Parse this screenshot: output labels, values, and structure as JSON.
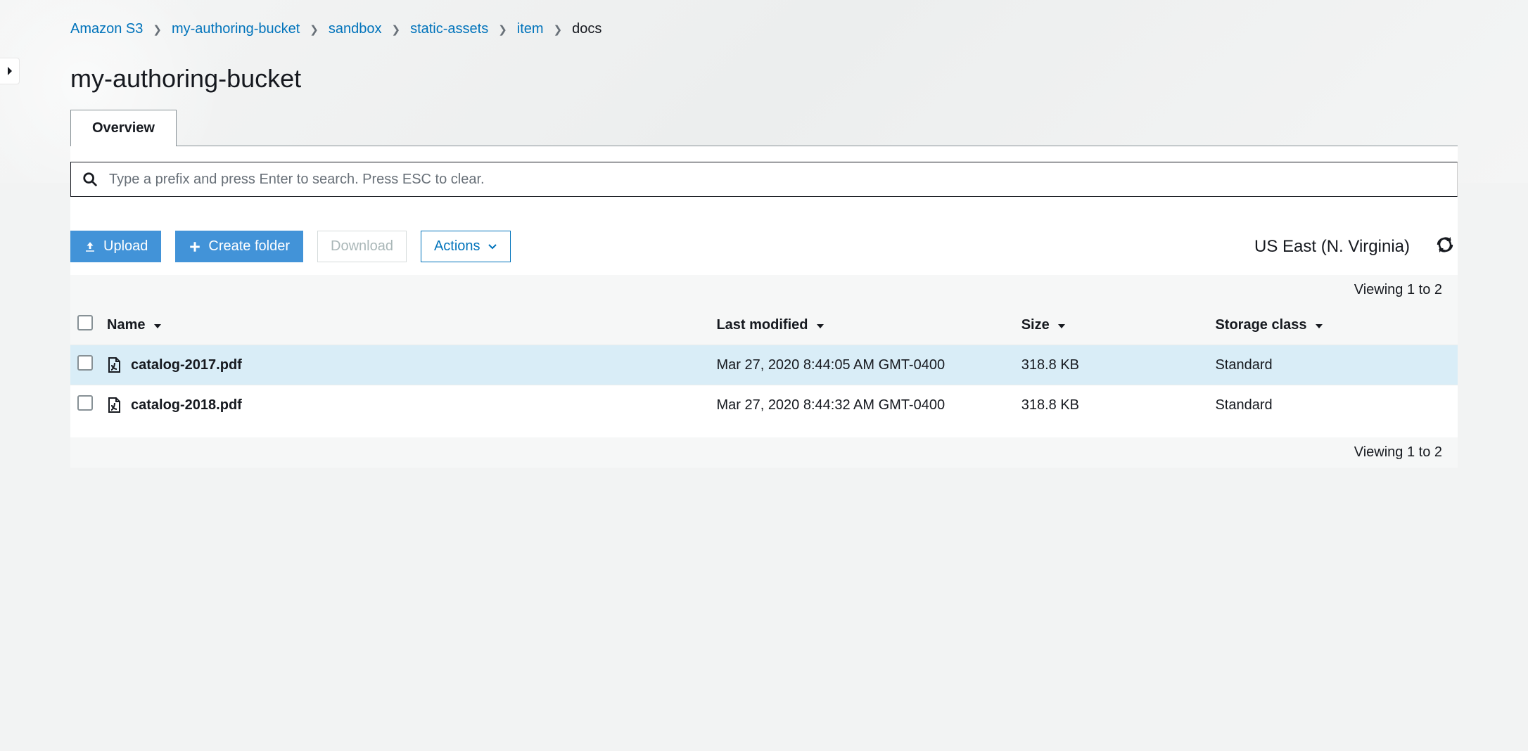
{
  "breadcrumb": {
    "items": [
      {
        "label": "Amazon S3",
        "link": true
      },
      {
        "label": "my-authoring-bucket",
        "link": true
      },
      {
        "label": "sandbox",
        "link": true
      },
      {
        "label": "static-assets",
        "link": true
      },
      {
        "label": "item",
        "link": true
      },
      {
        "label": "docs",
        "link": false
      }
    ]
  },
  "page_title": "my-authoring-bucket",
  "tabs": {
    "overview": "Overview"
  },
  "search": {
    "placeholder": "Type a prefix and press Enter to search. Press ESC to clear."
  },
  "toolbar": {
    "upload": "Upload",
    "create_folder": "Create folder",
    "download": "Download",
    "actions": "Actions",
    "region": "US East (N. Virginia)"
  },
  "viewing_top": "Viewing 1 to 2",
  "viewing_bottom": "Viewing 1 to 2",
  "columns": {
    "name": "Name",
    "last_modified": "Last modified",
    "size": "Size",
    "storage_class": "Storage class"
  },
  "objects": [
    {
      "name": "catalog-2017.pdf",
      "last_modified": "Mar 27, 2020 8:44:05 AM GMT-0400",
      "size": "318.8 KB",
      "storage_class": "Standard",
      "hovered": true
    },
    {
      "name": "catalog-2018.pdf",
      "last_modified": "Mar 27, 2020 8:44:32 AM GMT-0400",
      "size": "318.8 KB",
      "storage_class": "Standard",
      "hovered": false
    }
  ]
}
